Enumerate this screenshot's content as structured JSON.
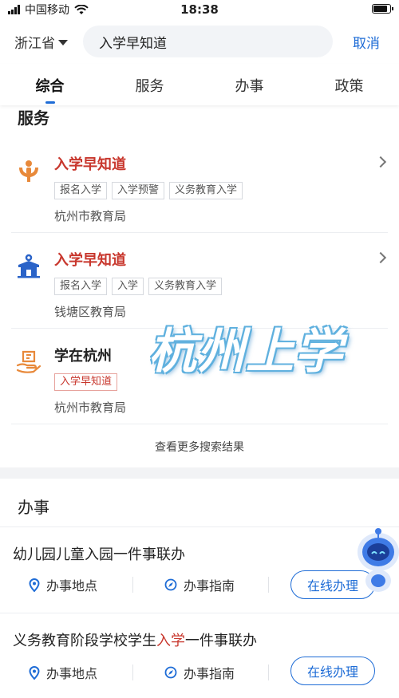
{
  "status_bar": {
    "carrier": "中国移动",
    "time": "18:38",
    "battery_level": 0.85
  },
  "header": {
    "region": "浙江省",
    "search_value": "入学早知道",
    "cancel": "取消"
  },
  "tabs": [
    {
      "label": "综合",
      "active": true
    },
    {
      "label": "服务",
      "active": false
    },
    {
      "label": "办事",
      "active": false
    },
    {
      "label": "政策",
      "active": false
    }
  ],
  "services": {
    "title": "服务",
    "items": [
      {
        "title": "入学早知道",
        "tags": [
          "报名入学",
          "入学预警",
          "义务教育入学"
        ],
        "org": "杭州市教育局",
        "icon": "hand-person-icon"
      },
      {
        "title": "入学早知道",
        "tags": [
          "报名入学",
          "入学",
          "义务教育入学"
        ],
        "org": "钱塘区教育局",
        "icon": "school-building-icon"
      },
      {
        "title": "学在杭州",
        "tags": [
          "入学早知道"
        ],
        "org": "杭州市教育局",
        "icon": "hand-book-icon"
      }
    ],
    "more": "查看更多搜索结果"
  },
  "overlay_text": "杭州上学",
  "tasks": {
    "title": "办事",
    "items": [
      {
        "title_pre": "幼儿园儿童入园一件事联办",
        "title_hl": "",
        "title_post": "",
        "location": "办事地点",
        "guide": "办事指南",
        "online": "在线办理"
      },
      {
        "title_pre": "义务教育阶段学校学生",
        "title_hl": "入学",
        "title_post": "一件事联办",
        "location": "办事地点",
        "guide": "办事指南",
        "online": "在线办理"
      }
    ]
  },
  "colors": {
    "accent": "#1e6cd6",
    "highlight_red": "#c8372d",
    "icon_orange": "#e8893a"
  }
}
